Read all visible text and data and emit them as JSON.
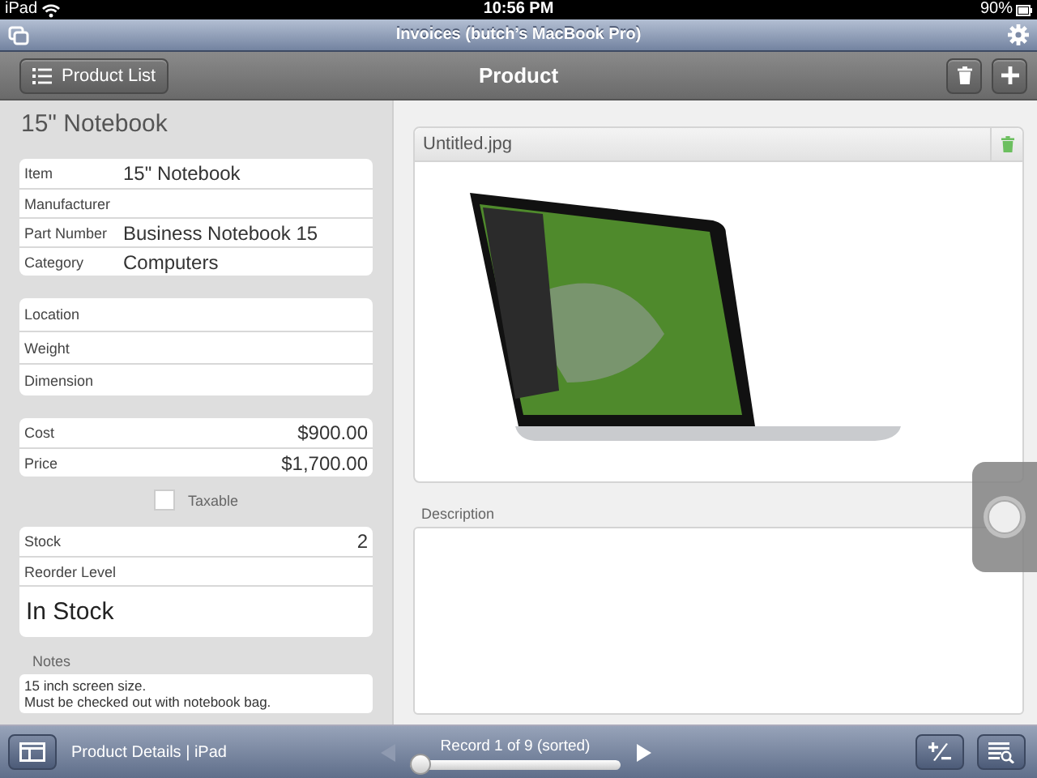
{
  "status_bar": {
    "carrier": "iPad",
    "time": "10:56 PM",
    "battery": "90%"
  },
  "title_bar": {
    "title": "Invoices (butch’s MacBook Pro)"
  },
  "toolbar": {
    "back_button": "Product List",
    "title": "Product"
  },
  "record_title": "15\" Notebook",
  "field_groups": [
    {
      "fields": [
        {
          "kind": "text",
          "label": "Item",
          "value": "15\" Notebook"
        },
        {
          "kind": "text",
          "label": "Manufacturer"
        },
        {
          "kind": "text",
          "label": "Part Number",
          "value": "Business Notebook 15"
        },
        {
          "kind": "text",
          "label": "Category",
          "value": "Computers"
        }
      ]
    },
    {
      "fields": [
        {
          "kind": "text",
          "label": "Location"
        },
        {
          "kind": "text",
          "label": "Weight"
        },
        {
          "kind": "text",
          "label": "Dimension"
        }
      ]
    },
    {
      "fields": [
        {
          "kind": "amount",
          "label": "Cost",
          "value": "$900.00"
        },
        {
          "kind": "amount",
          "label": "Price",
          "value": "$1,700.00"
        }
      ]
    },
    {
      "kind": "checkbox",
      "label": "Taxable",
      "checked": false
    },
    {
      "fields": [
        {
          "kind": "amount",
          "label": "Stock",
          "value": "2"
        },
        {
          "kind": "text",
          "label": "Reorder Level"
        },
        {
          "kind": "status",
          "value": "In Stock"
        }
      ]
    }
  ],
  "notes": {
    "label": "Notes",
    "lines": [
      "15 inch screen size.",
      "Must be checked out with notebook bag."
    ]
  },
  "image": {
    "filename": "Untitled.jpg"
  },
  "description": {
    "label": "Description"
  },
  "bottom_bar": {
    "layout": "Product Details | iPad",
    "record": "Record 1 of 9 (sorted)",
    "level": 0
  }
}
